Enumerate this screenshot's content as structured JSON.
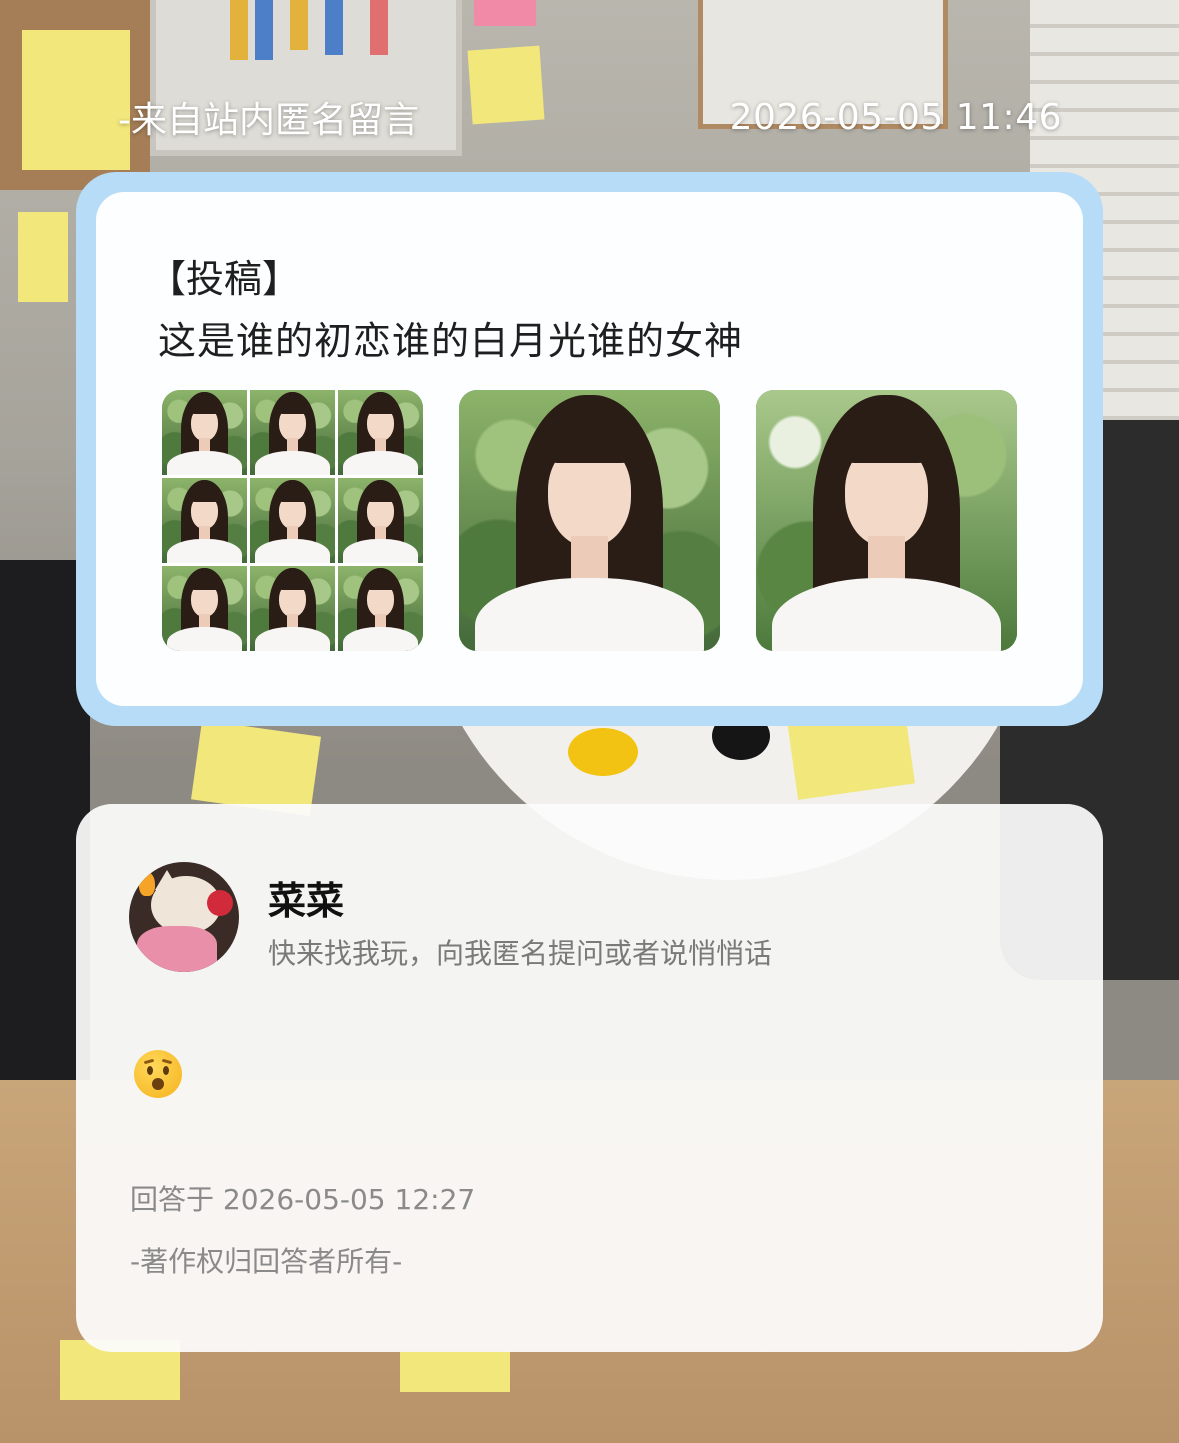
{
  "header": {
    "source": "-来自站内匿名留言",
    "timestamp": "2026-05-05 11:46"
  },
  "question": {
    "tag": "【投稿】",
    "text": "这是谁的初恋谁的白月光谁的女神",
    "card_color": "#b7dcf7",
    "images": [
      {
        "icon": "photo-collage-9-grid"
      },
      {
        "icon": "photo-portrait"
      },
      {
        "icon": "photo-portrait"
      }
    ]
  },
  "answer": {
    "name": "菜菜",
    "bio": "快来找我玩，向我匿名提问或者说悄悄话",
    "avatar_icon": "hello-kitty-avatar",
    "reply_emoji_icon": "astonished-face-emoji",
    "answered_at": "回答于 2026-05-05 12:27",
    "copyright": "-著作权归回答者所有-"
  }
}
